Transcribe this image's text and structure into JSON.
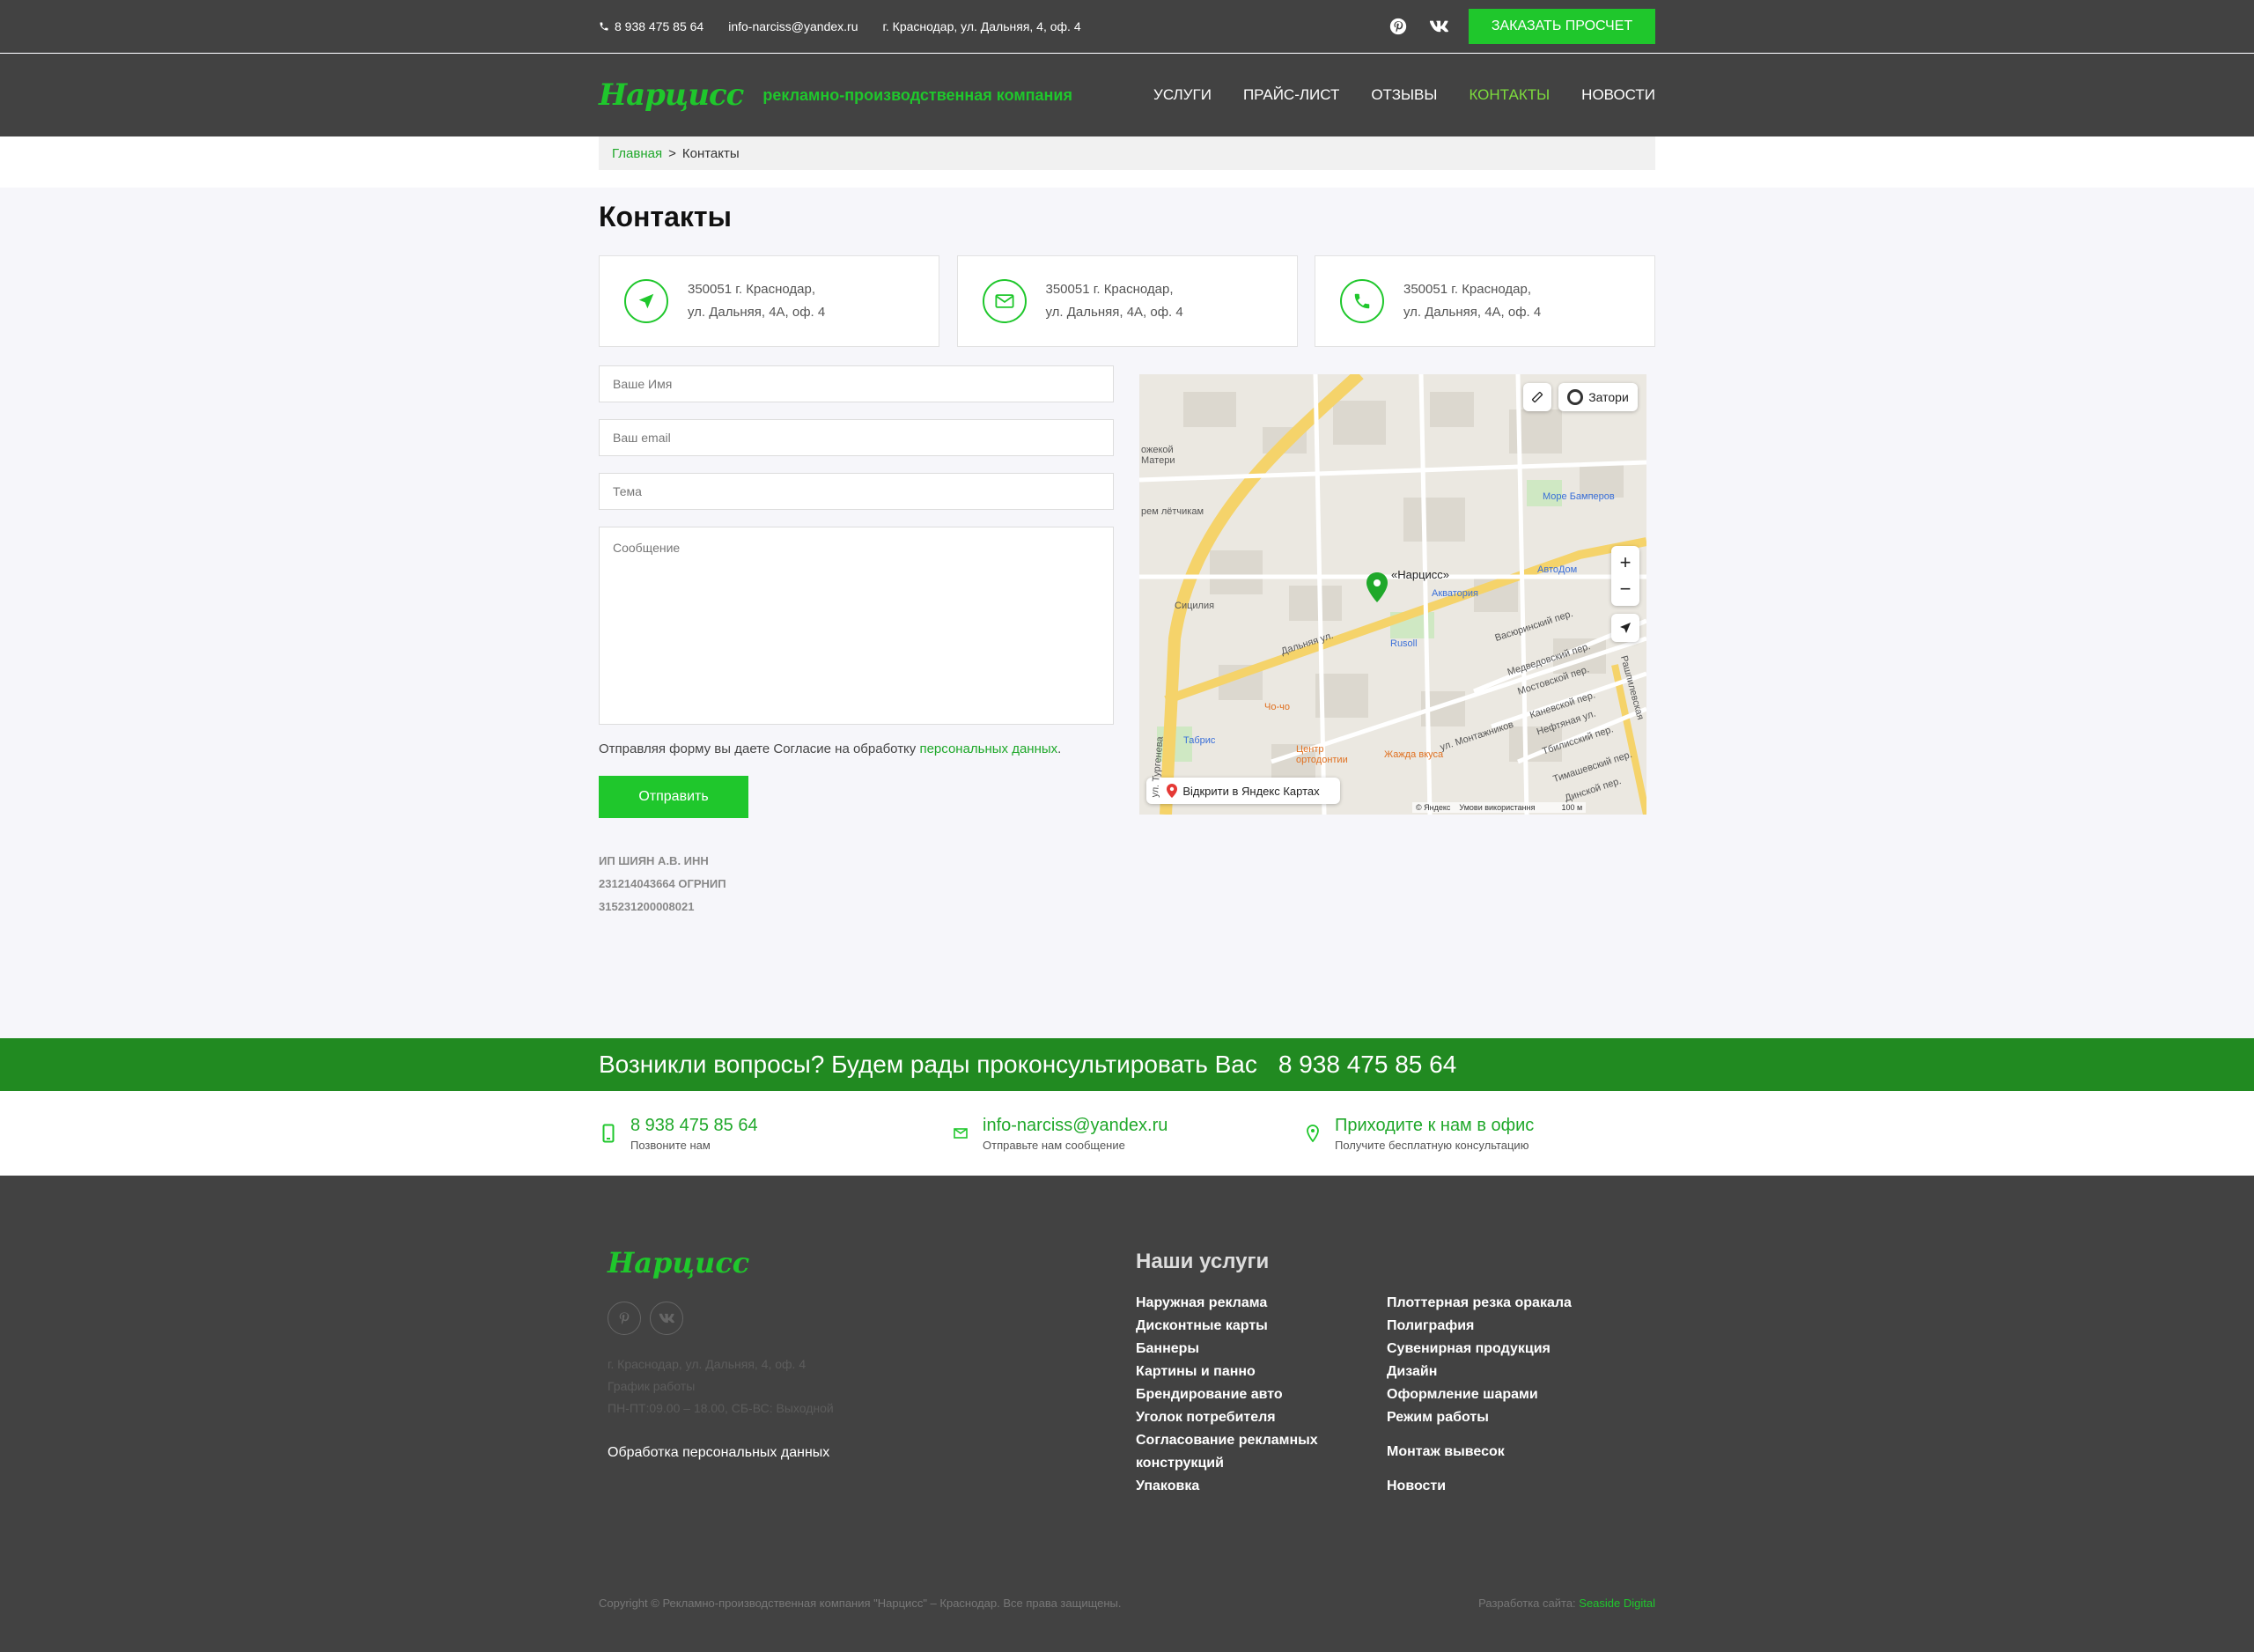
{
  "topbar": {
    "phone": "8 938 475 85 64",
    "email": "info-narciss@yandex.ru",
    "address": "г. Краснодар, ул. Дальняя, 4, оф. 4",
    "order_button": "ЗАКАЗАТЬ ПРОСЧЕТ"
  },
  "header": {
    "logo": "Нарцисс",
    "tagline": "рекламно-производственная компания",
    "nav": [
      "УСЛУГИ",
      "ПРАЙС-ЛИСТ",
      "ОТЗЫВЫ",
      "КОНТАКТЫ",
      "НОВОСТИ"
    ]
  },
  "breadcrumb": {
    "home": "Главная",
    "sep": ">",
    "current": "Контакты"
  },
  "page_title": "Контакты",
  "cards": [
    {
      "icon": "navigation-arrow-icon",
      "line1": "350051 г. Краснодар,",
      "line2": "ул. Дальняя, 4А, оф. 4"
    },
    {
      "icon": "envelope-icon",
      "line1": "350051 г. Краснодар,",
      "line2": "ул. Дальняя, 4А, оф. 4"
    },
    {
      "icon": "phone-icon",
      "line1": "350051 г. Краснодар,",
      "line2": "ул. Дальняя, 4А, оф. 4"
    }
  ],
  "form": {
    "name_placeholder": "Ваше Имя",
    "email_placeholder": "Ваш email",
    "subject_placeholder": "Тема",
    "message_placeholder": "Сообщение",
    "consent_text": "Отправляя форму вы даете Согласие на обработку ",
    "consent_link": "персональных данных",
    "consent_end": ".",
    "submit": "Отправить"
  },
  "legal": {
    "line1": "ИП ШИЯН А.В. ИНН",
    "line2": "231214043664 ОГРНИП",
    "line3": "315231200008021"
  },
  "map": {
    "traffic_label": "Затори",
    "place_label": "«Нарцисс»",
    "open_label": "Відкрити в Яндекс Картах",
    "copyright": "© Яндекс",
    "terms": "Умови використання",
    "scale": "100 м",
    "labels": {
      "more_bamperov": "Море Бамперов",
      "avtodom": "АвтоДом",
      "akvatoria": "Акватория",
      "rusoll": "Rusoll",
      "sicilia": "Сицилия",
      "chocho": "Чо-чо",
      "tabris": "Табрис",
      "center_orto": "Центр ортодонтии",
      "zhazhda": "Жажда вкуса",
      "dalnyaya": "Дальняя ул.",
      "turgeneva": "ул. Тургенева",
      "montazhnikov": "ул. Монтажников",
      "vasyurinsky": "Васюринский пер.",
      "medvedovsky": "Медведовский пер.",
      "mostovskoy": "Мостовской пер.",
      "kanevskoy": "Каневской пер.",
      "neftyanaya": "Нефтяная ул.",
      "tbilissky": "Тбилисский пер.",
      "timashevsky": "Тимашевский пер.",
      "dinskoy": "Динской пер.",
      "rashpilevskaya": "Рашпилевская",
      "rozhd": "ожекой Матери",
      "letchikam": "рем лётчикам"
    }
  },
  "cta": {
    "text": "Возникли вопросы? Будем рады проконсультировать Вас",
    "phone": "8 938 475 85 64"
  },
  "contact_strip": [
    {
      "icon": "mobile-icon",
      "title": "8 938 475 85 64",
      "sub": "Позвоните нам"
    },
    {
      "icon": "mail-icon",
      "title": "info-narciss@yandex.ru",
      "sub": "Отправьте нам сообщение"
    },
    {
      "icon": "location-pin-icon",
      "title": "Приходите к нам в офис",
      "sub": "Получите бесплатную консультацию"
    }
  ],
  "footer": {
    "logo": "Нарцисс",
    "address": "г. Краснодар, ул. Дальняя, 4, оф. 4",
    "schedule_title": "График работы",
    "schedule": "ПН-ПТ:09.00 – 18.00, СБ-ВС: Выходной",
    "privacy": "Обработка персональных данных",
    "services_title": "Наши услуги",
    "col1": [
      "Наружная реклама",
      "Дисконтные карты",
      "Баннеры",
      "Картины и панно",
      "Брендирование авто",
      "Уголок потребителя",
      "Согласование рекламных",
      "конструкций",
      "Упаковка"
    ],
    "col2": [
      "Плоттерная резка оракала",
      "Полиграфия",
      "Сувенирная продукция",
      "Дизайн",
      "Оформление шарами",
      "Режим работы",
      "",
      "Монтаж вывесок",
      "",
      "Новости"
    ],
    "copyright": "Copyright © Рекламно-производственная компания \"Нарцисс\" – Краснодар. Все права защищены.",
    "dev_label": "Разработка сайта: ",
    "dev_name": "Seaside Digital"
  }
}
